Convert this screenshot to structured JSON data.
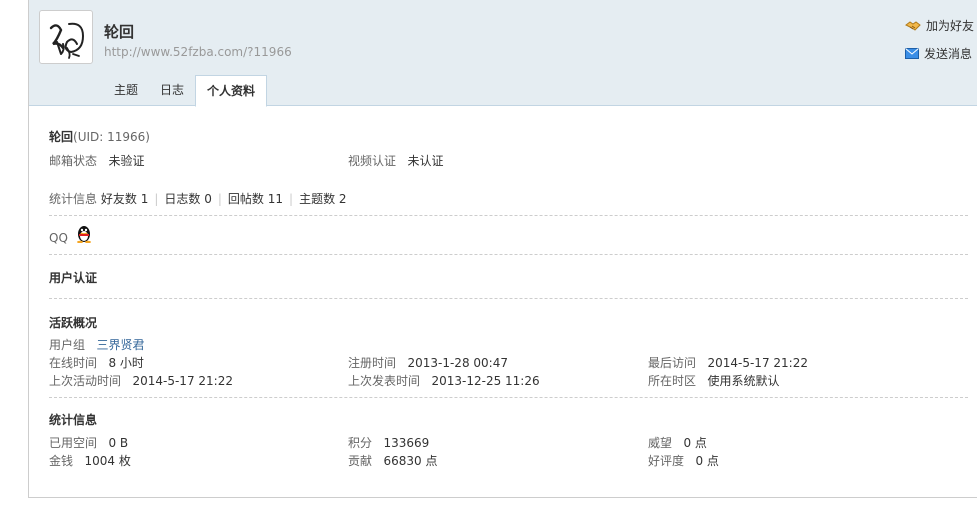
{
  "header": {
    "username": "轮回",
    "url": "http://www.52fzba.com/?11966",
    "add_friend_label": "加为好友",
    "send_message_label": "发送消息"
  },
  "tabs": [
    {
      "label": "主题"
    },
    {
      "label": "日志"
    },
    {
      "label": "个人资料",
      "active": true
    }
  ],
  "profile": {
    "name": "轮回",
    "uid": "(UID: 11966)",
    "email_status_label": "邮箱状态",
    "email_status_value": "未验证",
    "video_auth_label": "视频认证",
    "video_auth_value": "未认证",
    "stats_label": "统计信息",
    "stats": [
      {
        "label": "好友数",
        "value": "1"
      },
      {
        "label": "日志数",
        "value": "0"
      },
      {
        "label": "回帖数",
        "value": "11"
      },
      {
        "label": "主题数",
        "value": "2"
      }
    ],
    "qq_label": "QQ"
  },
  "sections": {
    "user_auth": "用户认证",
    "activity": "活跃概况",
    "stats_info": "统计信息"
  },
  "activity": {
    "group_label": "用户组",
    "group_value": "三界贤君",
    "online_label": "在线时间",
    "online_value": "8 小时",
    "register_label": "注册时间",
    "register_value": "2013-1-28 00:47",
    "last_visit_label": "最后访问",
    "last_visit_value": "2014-5-17 21:22",
    "last_active_label": "上次活动时间",
    "last_active_value": "2014-5-17 21:22",
    "last_post_label": "上次发表时间",
    "last_post_value": "2013-12-25 11:26",
    "timezone_label": "所在时区",
    "timezone_value": "使用系统默认"
  },
  "statistics": {
    "space_label": "已用空间",
    "space_value": "0 B",
    "points_label": "积分",
    "points_value": "133669",
    "prestige_label": "威望",
    "prestige_value": "0 点",
    "money_label": "金钱",
    "money_value": "1004 枚",
    "contribution_label": "贡献",
    "contribution_value": "66830 点",
    "rating_label": "好评度",
    "rating_value": "0 点"
  },
  "icons": {
    "add_friend": "handshake-icon",
    "send_message": "envelope-icon",
    "qq": "qq-penguin-icon",
    "avatar": "calligraphy-avatar"
  },
  "colors": {
    "header_bg": "#e5edf2",
    "border": "#c2d5e3",
    "link": "#336699",
    "muted": "#999999"
  }
}
